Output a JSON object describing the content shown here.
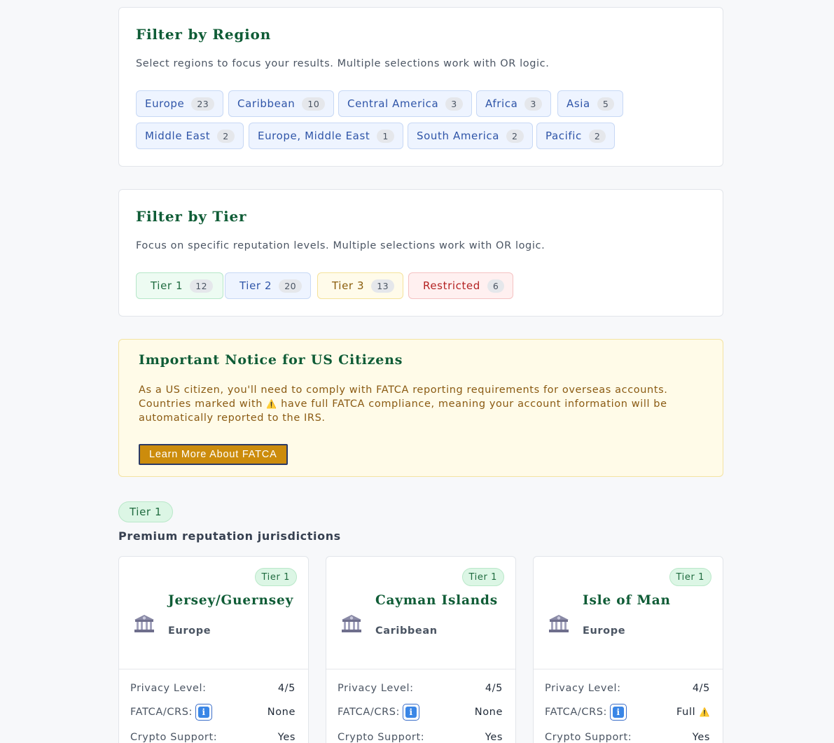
{
  "region_filter": {
    "title": "Filter by Region",
    "description": "Select regions to focus your results. Multiple selections work with OR logic.",
    "chips": [
      {
        "label": "Europe",
        "count": "23"
      },
      {
        "label": "Caribbean",
        "count": "10"
      },
      {
        "label": "Central America",
        "count": "3"
      },
      {
        "label": "Africa",
        "count": "3"
      },
      {
        "label": "Asia",
        "count": "5"
      },
      {
        "label": "Middle East",
        "count": "2"
      },
      {
        "label": "Europe, Middle East",
        "count": "1"
      },
      {
        "label": "South America",
        "count": "2"
      },
      {
        "label": "Pacific",
        "count": "2"
      }
    ]
  },
  "tier_filter": {
    "title": "Filter by Tier",
    "description": "Focus on specific reputation levels. Multiple selections work with OR logic.",
    "chips": [
      {
        "label": "Tier 1",
        "count": "12"
      },
      {
        "label": "Tier 2",
        "count": "20"
      },
      {
        "label": "Tier 3",
        "count": "13"
      },
      {
        "label": "Restricted",
        "count": "6"
      }
    ]
  },
  "notice": {
    "title": "Important Notice for US Citizens",
    "line1": "As a US citizen, you'll need to comply with FATCA reporting requirements for overseas accounts.",
    "line2_before": "Countries marked with",
    "warning_glyph": "⚠️",
    "line2_after": "have full FATCA compliance, meaning your account information will be",
    "line3": "automatically reported to the IRS.",
    "button_label": "Learn More About FATCA"
  },
  "section": {
    "pill": "Tier 1",
    "subtitle": "Premium reputation jurisdictions"
  },
  "card_labels": {
    "privacy": "Privacy Level:",
    "fatca": "FATCA/CRS:",
    "crypto": "Crypto Support:",
    "info_glyph": "i",
    "bank_icon": "bank-icon"
  },
  "cards": [
    {
      "badge": "Tier 1",
      "name": "Jersey/Guernsey",
      "region": "Europe",
      "privacy": "4/5",
      "fatca": "None",
      "crypto": "Yes"
    },
    {
      "badge": "Tier 1",
      "name": "Cayman Islands",
      "region": "Caribbean",
      "privacy": "4/5",
      "fatca": "None",
      "crypto": "Yes"
    },
    {
      "badge": "Tier 1",
      "name": "Isle of Man",
      "region": "Europe",
      "privacy": "4/5",
      "fatca": "Full",
      "fatca_warning": "⚠️",
      "crypto": "Yes"
    }
  ],
  "colors": {
    "title_green": "#0f5c36",
    "region_chip_text": "#2f55a8",
    "notice_button": "#cc8c0c",
    "crypto_yes": "#1f9a55",
    "fatca_full": "#d03a3a"
  }
}
